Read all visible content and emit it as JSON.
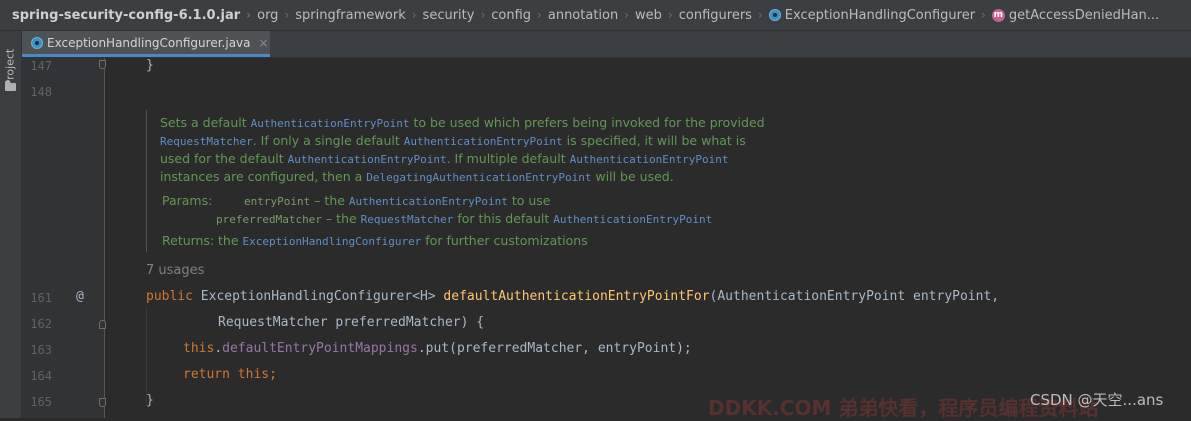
{
  "breadcrumb": {
    "items": [
      "spring-security-config-6.1.0.jar",
      "org",
      "springframework",
      "security",
      "config",
      "annotation",
      "web",
      "configurers"
    ],
    "class_item": "ExceptionHandlingConfigurer",
    "method_icon_letter": "m",
    "method_item": "getAccessDeniedHan..."
  },
  "toolwindow": {
    "project_label": "Project"
  },
  "tabs": [
    {
      "label": "ExceptionHandlingConfigurer.java",
      "close": "×"
    }
  ],
  "editor": {
    "line_numbers": [
      "147",
      "148",
      "161",
      "162",
      "163",
      "164",
      "165"
    ],
    "at_marker": "@",
    "usages": "7 usages",
    "doc": {
      "desc_lines": [
        [
          [
            "t",
            "Sets a default "
          ],
          [
            "c",
            "AuthenticationEntryPoint"
          ],
          [
            "t",
            " to be used which prefers being invoked for the provided"
          ]
        ],
        [
          [
            "c",
            "RequestMatcher"
          ],
          [
            "t",
            ". If only a single default "
          ],
          [
            "c",
            "AuthenticationEntryPoint"
          ],
          [
            "t",
            " is specified, it will be what is"
          ]
        ],
        [
          [
            "t",
            "used for the default "
          ],
          [
            "c",
            "AuthenticationEntryPoint"
          ],
          [
            "t",
            ". If multiple default "
          ],
          [
            "c",
            "AuthenticationEntryPoint"
          ]
        ],
        [
          [
            "t",
            "instances are configured, then a "
          ],
          [
            "c",
            "DelegatingAuthenticationEntryPoint"
          ],
          [
            "t",
            " will be used."
          ]
        ]
      ],
      "params_label": "Params:",
      "param_lines": [
        [
          [
            "g",
            "entryPoint"
          ],
          [
            "t",
            " – the "
          ],
          [
            "c",
            "AuthenticationEntryPoint"
          ],
          [
            "t",
            " to use"
          ]
        ],
        [
          [
            "g",
            "preferredMatcher"
          ],
          [
            "t",
            " – the "
          ],
          [
            "c",
            "RequestMatcher"
          ],
          [
            "t",
            " for this default "
          ],
          [
            "c",
            "AuthenticationEntryPoint"
          ]
        ]
      ],
      "returns_label": "Returns:",
      "returns_line": [
        [
          "t",
          "the "
        ],
        [
          "c",
          "ExceptionHandlingConfigurer"
        ],
        [
          "t",
          " for further customizations"
        ]
      ]
    },
    "code": {
      "line147": "}",
      "line161_kw": "public",
      "line161_type": " ExceptionHandlingConfigurer<H> ",
      "line161_fn": "defaultAuthenticationEntryPointFor",
      "line161_rest": "(AuthenticationEntryPoint entryPoint,",
      "line162": "RequestMatcher preferredMatcher) {",
      "line163_kw": "this",
      "line163_dot": ".",
      "line163_fld": "defaultEntryPointMappings",
      "line163_rest": ".put(preferredMatcher, entryPoint);",
      "line164_kw1": "return",
      "line164_sp": " ",
      "line164_kw2": "this",
      "line164_semi": ";",
      "line165": "}"
    }
  },
  "watermarks": {
    "left": "DDKK.COM 弟弟快看，程序员编程资料站",
    "right": "CSDN @天空...ans"
  },
  "colors": {
    "keyword": "#cc7832",
    "function": "#ffc66d",
    "field": "#9876aa",
    "doc_text": "#629755",
    "doc_code": "#5f8ec9"
  }
}
